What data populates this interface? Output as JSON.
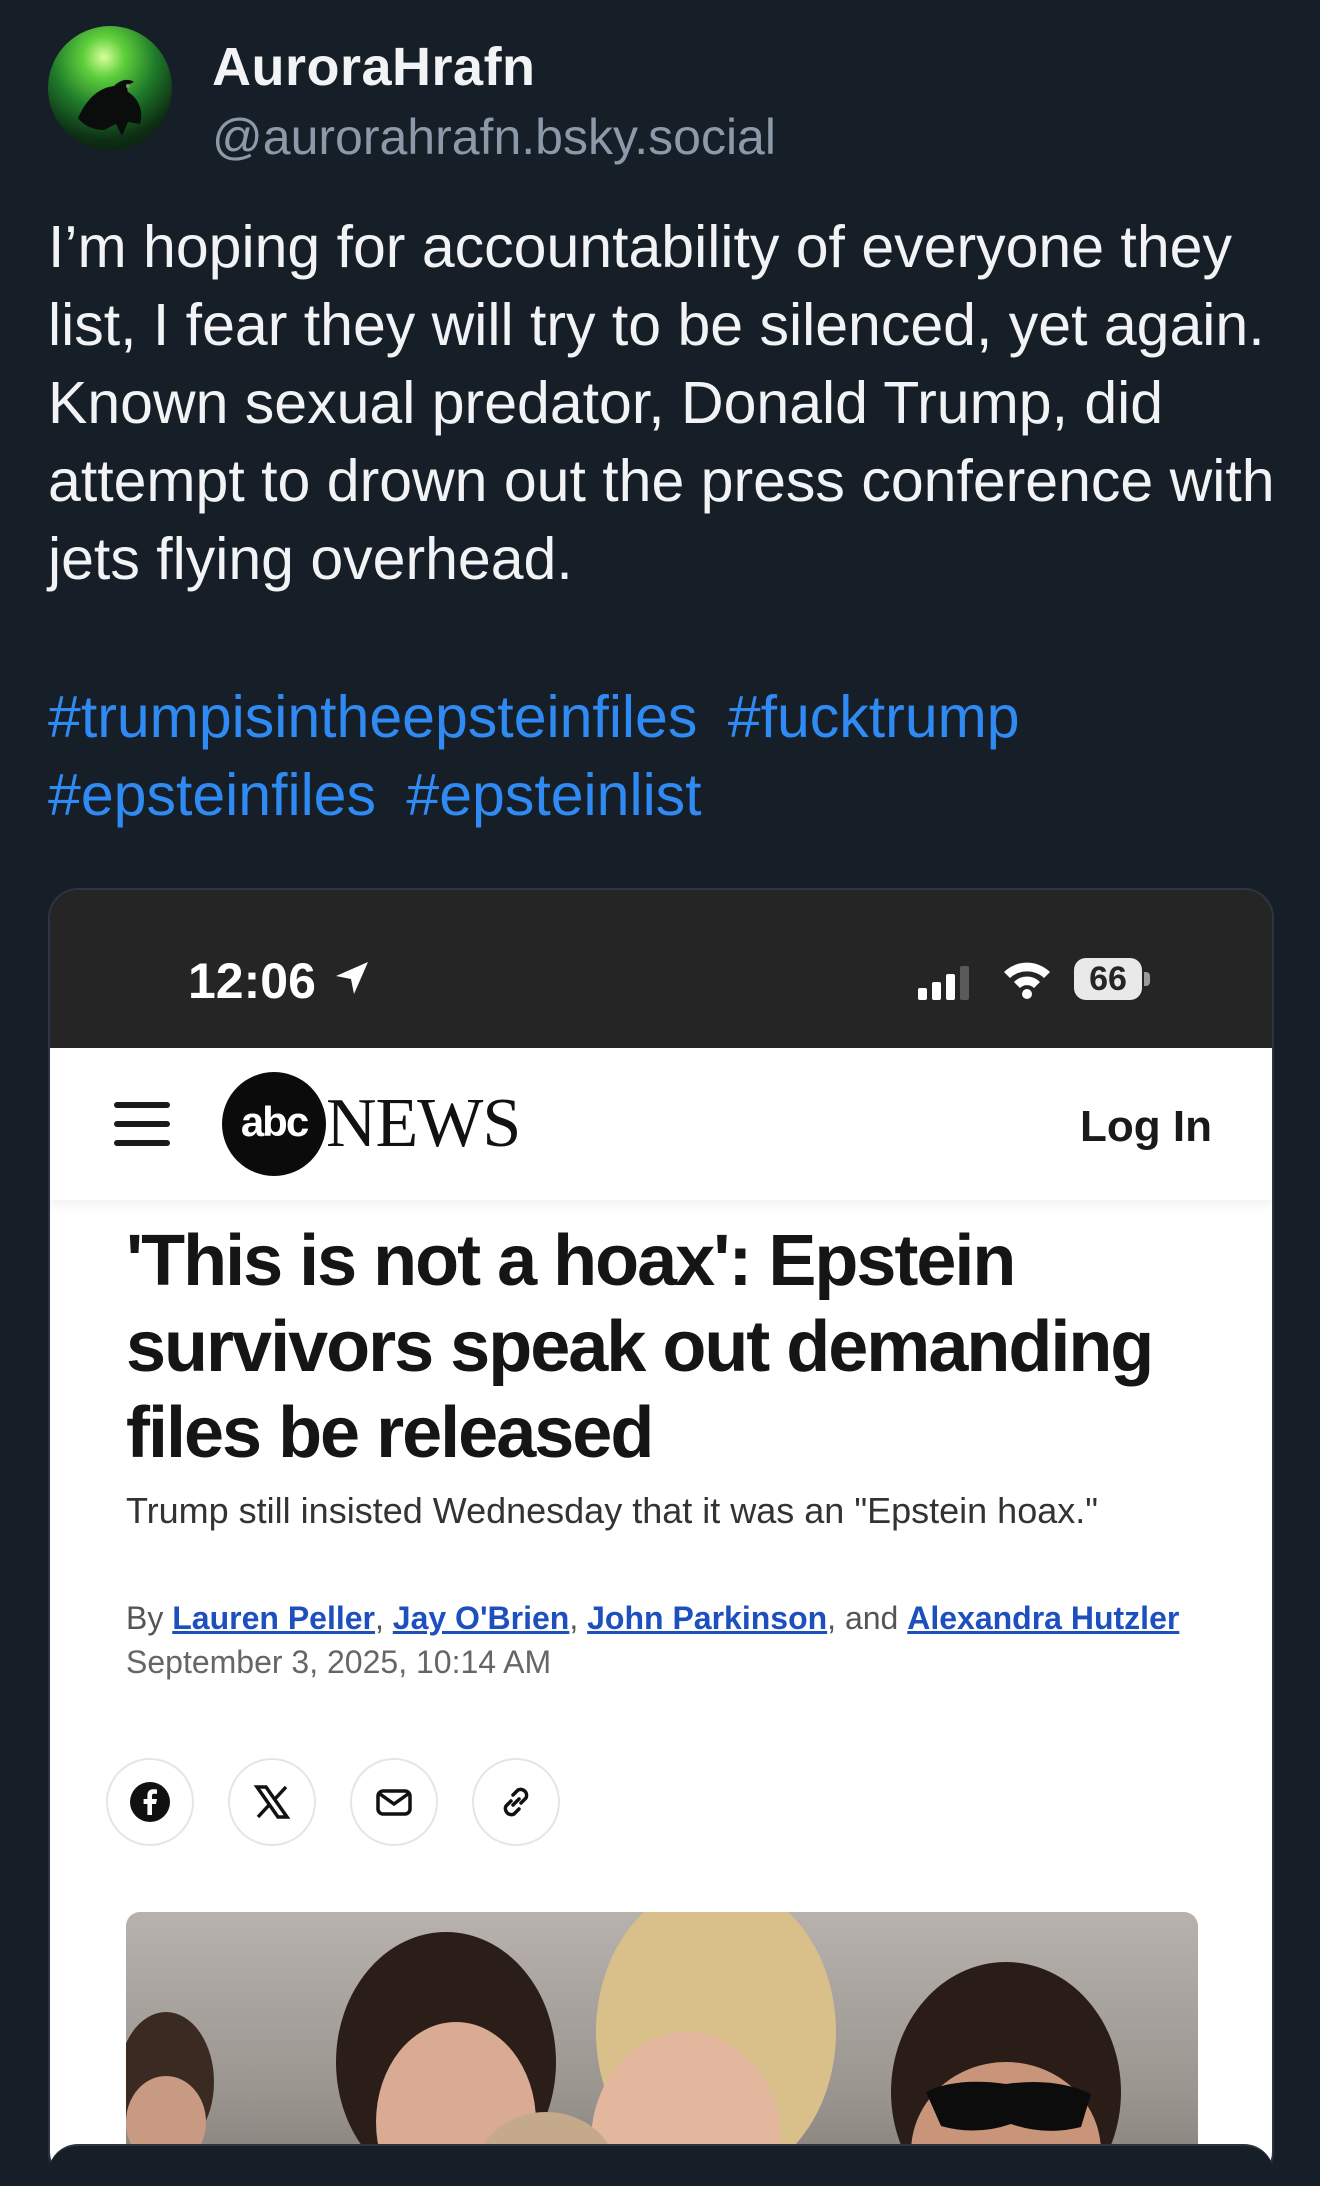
{
  "post": {
    "display_name": "AuroraHrafn",
    "handle": "@aurorahrafn.bsky.social",
    "text": "I’m hoping for accountability of everyone they list, I fear they will try to be silenced, yet again. Known sexual predator, Donald Trump, did attempt to drown out the press conference with jets flying overhead.",
    "hashtags": [
      "#trumpisintheepsteinfiles",
      "#fucktrump",
      "#epsteinfiles",
      "#epsteinlist"
    ]
  },
  "embed": {
    "status_bar": {
      "time": "12:06",
      "battery": "66"
    },
    "site": {
      "logo_text": "abc",
      "logo_word": "NEWS",
      "login_label": "Log In"
    },
    "article": {
      "headline": "'This is not a hoax': Epstein survivors speak out demanding files be released",
      "dek": "Trump still insisted Wednesday that it was an \"Epstein hoax.\"",
      "by_prefix": "By",
      "authors": [
        "Lauren Peller",
        "Jay O'Brien",
        "John Parkinson",
        "Alexandra Hutzler"
      ],
      "separator_1": ",",
      "separator_2": ",",
      "separator_3": ", and",
      "date": "September 3, 2025, 10:14 AM",
      "share_icons": [
        "facebook-icon",
        "x-icon",
        "mail-icon",
        "link-icon"
      ]
    }
  },
  "colors": {
    "background": "#161e27",
    "hashtag": "#2f8bf3",
    "handle": "#8c99a8",
    "author_link": "#1e4fbf"
  }
}
